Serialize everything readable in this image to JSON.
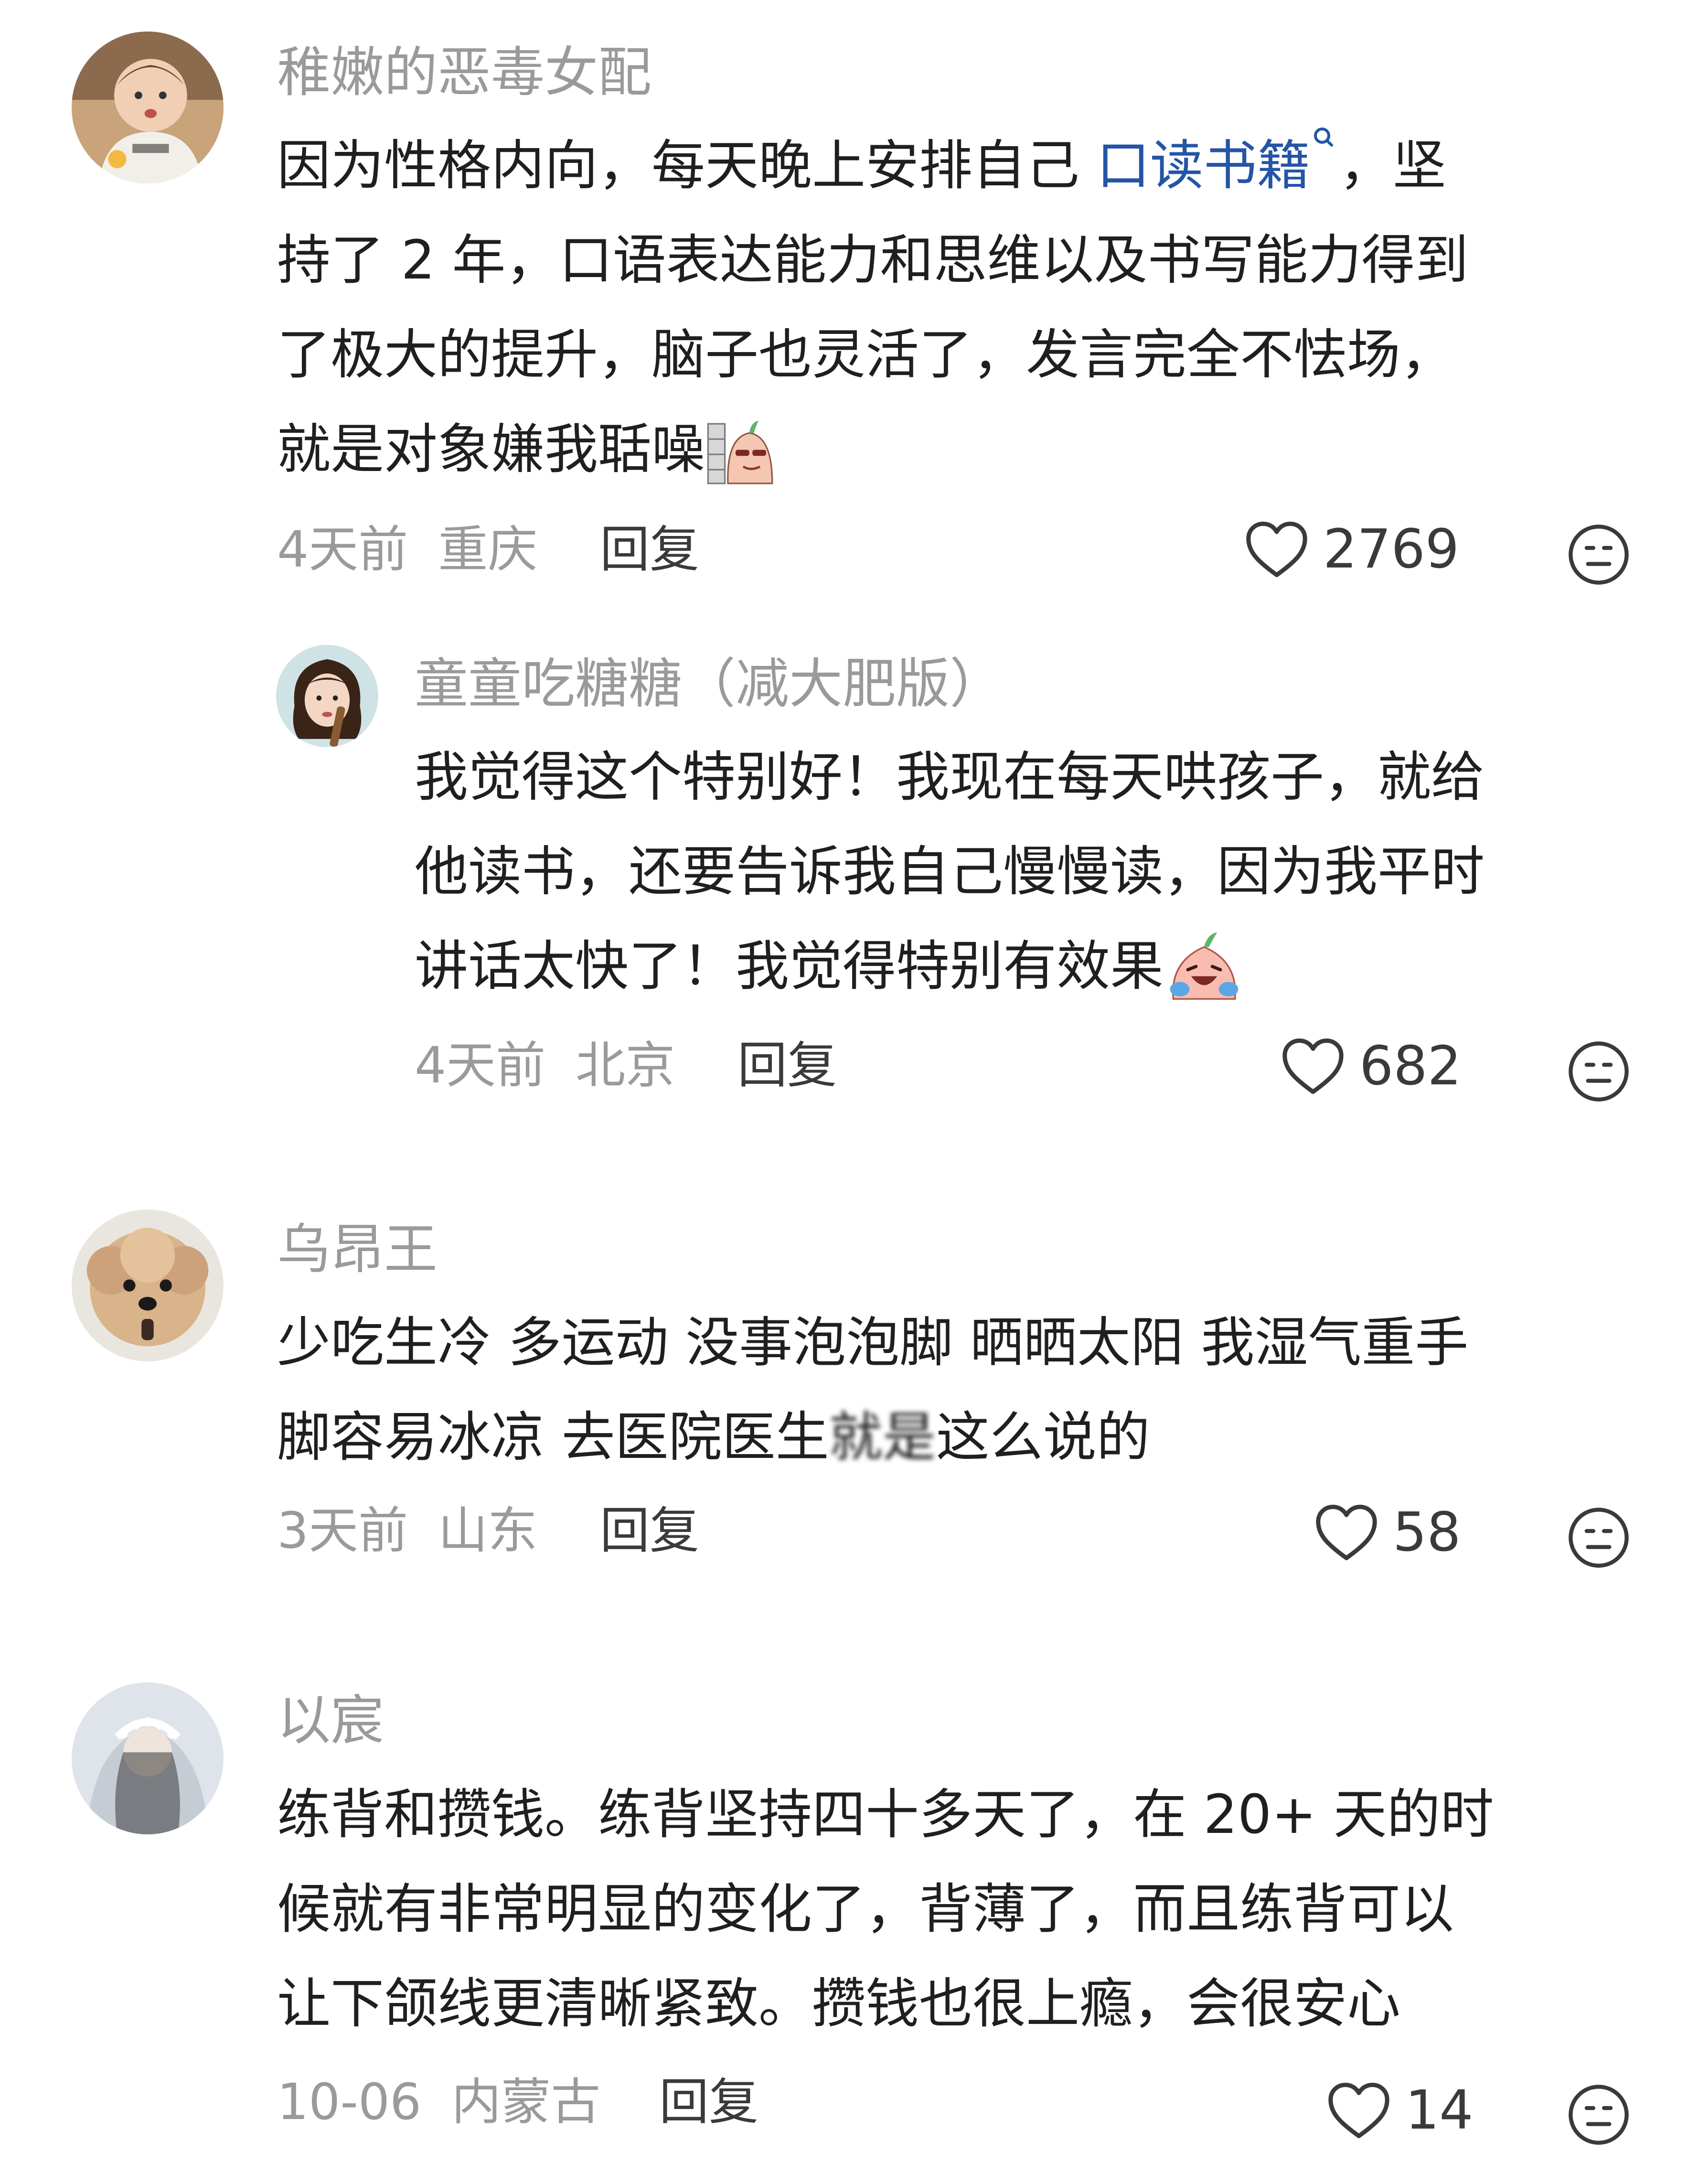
{
  "comments": [
    {
      "username": "稚嫩的恶毒女配",
      "lines": [
        {
          "pre": "因为性格内向，每天晚上安排自己 ",
          "link": "口读书籍",
          "post": "，坚"
        },
        {
          "text": "持了 2 年，口语表达能力和思维以及书写能力得到"
        },
        {
          "text": "了极大的提升，脑子也灵活了，发言完全不怯场，"
        },
        {
          "text": "就是对象嫌我聒噪"
        }
      ],
      "time": "4天前",
      "location": "重庆",
      "reply_label": "回复",
      "likes": "2769",
      "replies": [
        {
          "username": "童童吃糖糖（减大肥版）",
          "lines": [
            {
              "text": "我觉得这个特别好！我现在每天哄孩子，就给"
            },
            {
              "text": "他读书，还要告诉我自己慢慢读，因为我平时"
            },
            {
              "text": "讲话太快了！我觉得特别有效果"
            }
          ],
          "time": "4天前",
          "location": "北京",
          "reply_label": "回复",
          "likes": "682"
        }
      ]
    },
    {
      "username": "乌昂王",
      "lines": [
        {
          "text": "少吃生冷 多运动 没事泡泡脚 晒晒太阳 我湿气重手"
        },
        {
          "pre": "脚容易冰凉 去医院医生",
          "blur": "就是",
          "post": "这么说的"
        }
      ],
      "time": "3天前",
      "location": "山东",
      "reply_label": "回复",
      "likes": "58"
    },
    {
      "username": "以宸",
      "lines": [
        {
          "text": "练背和攒钱。练背坚持四十多天了，在 20+ 天的时"
        },
        {
          "text": "候就有非常明显的变化了，背薄了，而且练背可以"
        },
        {
          "text": "让下颌线更清晰紧致。攒钱也很上瘾，会很安心"
        }
      ],
      "time": "10-06",
      "location": "内蒙古",
      "reply_label": "回复",
      "likes": "14"
    }
  ],
  "colors": {
    "link": "#2455a6",
    "muted": "#9a9a9a",
    "text": "#1f1f1f"
  },
  "icons": {
    "like": "heart-outline-icon",
    "dislike": "neutral-face-icon",
    "search_hint": "search-icon"
  }
}
